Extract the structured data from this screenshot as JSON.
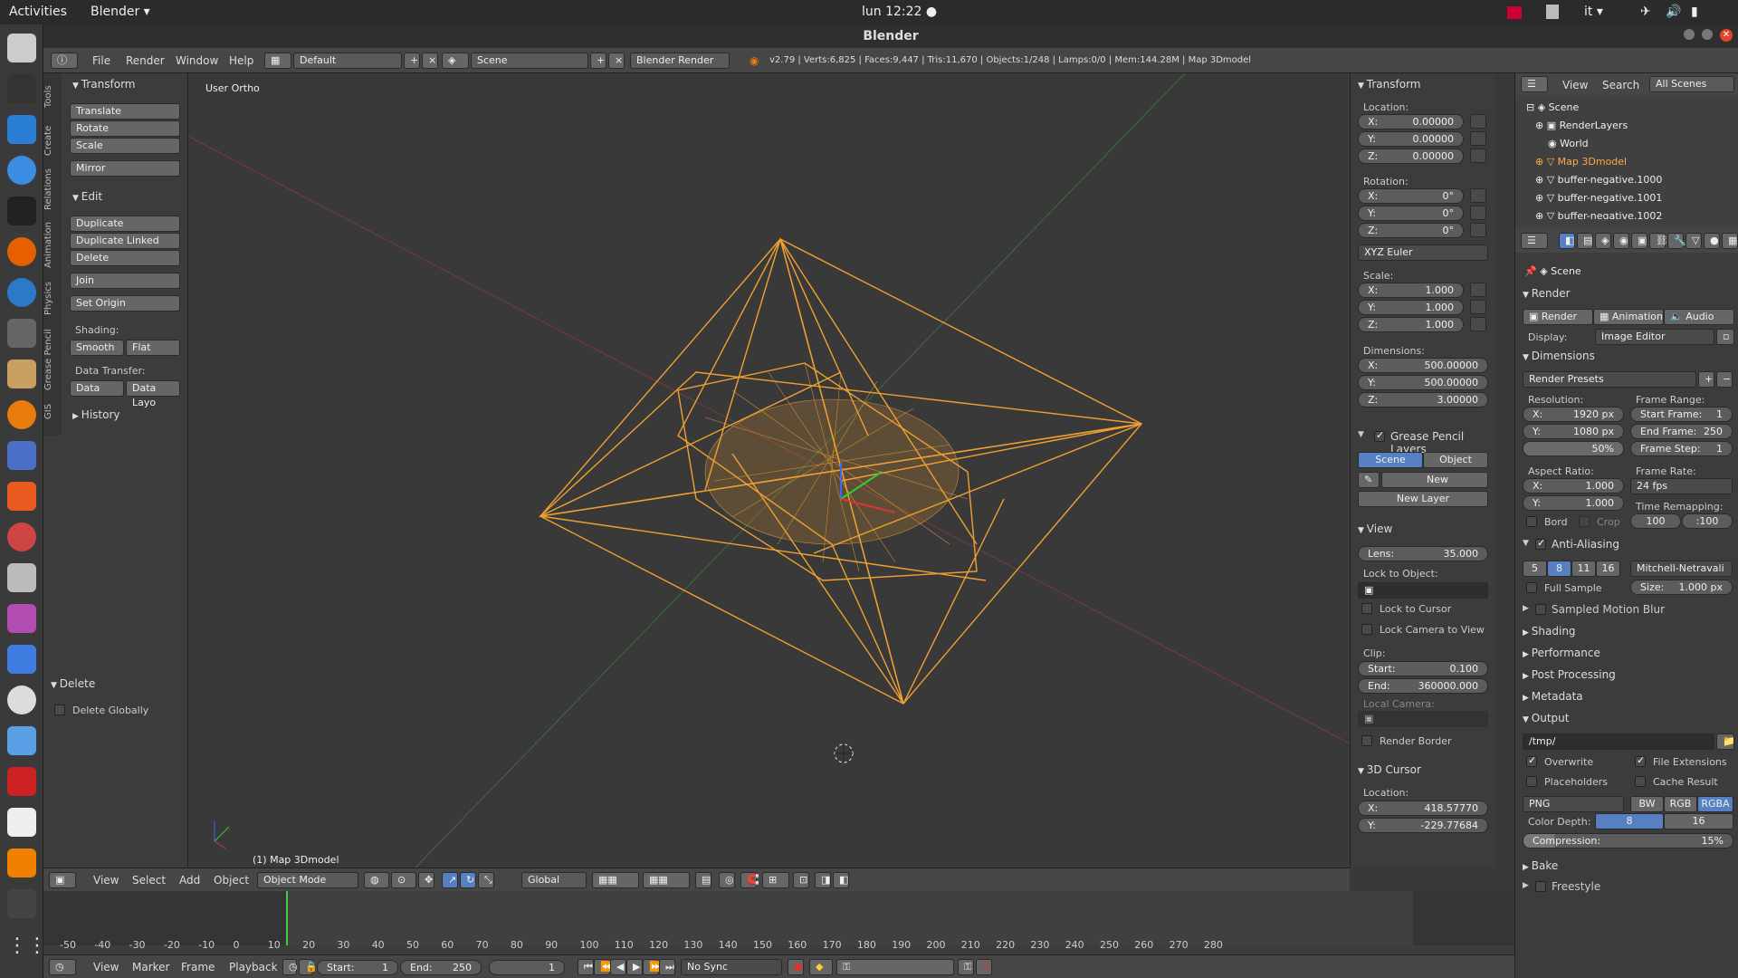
{
  "topbar": {
    "activities": "Activities",
    "app": "Blender ▾",
    "clock": "lun 12:22 ●",
    "lang": "it ▾"
  },
  "window": {
    "title": "Blender"
  },
  "infobar": {
    "menus": [
      "File",
      "Render",
      "Window",
      "Help"
    ],
    "layout": "Default",
    "scene": "Scene",
    "engine": "Blender Render",
    "stats": "v2.79 | Verts:6,825 | Faces:9,447 | Tris:11,670 | Objects:1/248 | Lamps:0/0 | Mem:144.28M | Map 3Dmodel"
  },
  "tools": {
    "tabs": [
      "Tools",
      "Create",
      "Relations",
      "Animation",
      "Physics",
      "Grease Pencil",
      "GIS"
    ],
    "transform_title": "Transform",
    "translate": "Translate",
    "rotate": "Rotate",
    "scale": "Scale",
    "mirror": "Mirror",
    "edit_title": "Edit",
    "duplicate": "Duplicate",
    "duplicate_linked": "Duplicate Linked",
    "delete": "Delete",
    "join": "Join",
    "set_origin": "Set Origin",
    "shading_label": "Shading:",
    "smooth": "Smooth",
    "flat": "Flat",
    "data_transfer_label": "Data Transfer:",
    "data": "Data",
    "data_layo": "Data Layo",
    "history_title": "History",
    "delete_panel_title": "Delete",
    "delete_globally": "Delete Globally"
  },
  "viewport": {
    "view_name": "User Ortho",
    "object_label": "(1) Map 3Dmodel"
  },
  "npanel": {
    "transform_title": "Transform",
    "location_label": "Location:",
    "loc_x": "0.00000",
    "loc_y": "0.00000",
    "loc_z": "0.00000",
    "rotation_label": "Rotation:",
    "rot_x": "0°",
    "rot_y": "0°",
    "rot_z": "0°",
    "rot_mode": "XYZ Euler",
    "scale_label": "Scale:",
    "scale_x": "1.000",
    "scale_y": "1.000",
    "scale_z": "1.000",
    "dimensions_label": "Dimensions:",
    "dim_x": "500.00000",
    "dim_y": "500.00000",
    "dim_z": "3.00000",
    "gp_title": "Grease Pencil Layers",
    "gp_scene": "Scene",
    "gp_object": "Object",
    "gp_new": "New",
    "gp_new_layer": "New Layer",
    "view_title": "View",
    "lens_label": "Lens:",
    "lens": "35.000",
    "lock_to_object": "Lock to Object:",
    "lock_to_cursor": "Lock to Cursor",
    "lock_camera": "Lock Camera to View",
    "clip_label": "Clip:",
    "clip_start_label": "Start:",
    "clip_start": "0.100",
    "clip_end_label": "End:",
    "clip_end": "360000.000",
    "local_camera": "Local Camera:",
    "render_border": "Render Border",
    "cursor_title": "3D Cursor",
    "cursor_location": "Location:",
    "cursor_x": "418.57770",
    "cursor_y": "-229.77684"
  },
  "outliner": {
    "view": "View",
    "search": "Search",
    "all_scenes": "All Scenes",
    "items": [
      "Scene",
      "RenderLayers",
      "World",
      "Map 3Dmodel",
      "buffer-negative.1000",
      "buffer-negative.1001",
      "buffer-negative.1002"
    ]
  },
  "props": {
    "scene": "Scene",
    "render_title": "Render",
    "render_btn": "Render",
    "animation_btn": "Animation",
    "audio_btn": "Audio",
    "display_label": "Display:",
    "display": "Image Editor",
    "dimensions_title": "Dimensions",
    "render_presets": "Render Presets",
    "resolution_label": "Resolution:",
    "res_x": "1920 px",
    "res_y": "1080 px",
    "res_pct": "50%",
    "frame_range_label": "Frame Range:",
    "start_frame": "Start Frame:",
    "start_frame_val": "1",
    "end_frame": "End Frame:",
    "end_frame_val": "250",
    "frame_step": "Frame Step:",
    "frame_step_val": "1",
    "aspect_label": "Aspect Ratio:",
    "aspect_x": "1.000",
    "aspect_y": "1.000",
    "frame_rate_label": "Frame Rate:",
    "fps": "24 fps",
    "time_remap_label": "Time Remapping:",
    "remap_old": "100",
    "remap_new": ":100",
    "bord": "Bord",
    "crop": "Crop",
    "aa_title": "Anti-Aliasing",
    "aa_samples": [
      "5",
      "8",
      "11",
      "16"
    ],
    "aa_filter": "Mitchell-Netravali",
    "full_sample": "Full Sample",
    "aa_size": "Size:",
    "aa_size_val": "1.000 px",
    "collapsed": [
      "Sampled Motion Blur",
      "Shading",
      "Performance",
      "Post Processing",
      "Metadata"
    ],
    "output_title": "Output",
    "output_path": "/tmp/",
    "overwrite": "Overwrite",
    "file_ext": "File Extensions",
    "placeholders": "Placeholders",
    "cache_result": "Cache Result",
    "format": "PNG",
    "bw": "BW",
    "rgb": "RGB",
    "rgba": "RGBA",
    "color_depth_label": "Color Depth:",
    "depth8": "8",
    "depth16": "16",
    "compression": "Compression:",
    "compression_val": "15%",
    "bake": "Bake",
    "freestyle": "Freestyle"
  },
  "vheader": {
    "view": "View",
    "select": "Select",
    "add": "Add",
    "object": "Object",
    "mode": "Object Mode",
    "orientation": "Global"
  },
  "timeline": {
    "ticks": [
      "-50",
      "-40",
      "-30",
      "-20",
      "-10",
      "0",
      "10",
      "20",
      "30",
      "40",
      "50",
      "60",
      "70",
      "80",
      "90",
      "100",
      "110",
      "120",
      "130",
      "140",
      "150",
      "160",
      "170",
      "180",
      "190",
      "200",
      "210",
      "220",
      "230",
      "240",
      "250",
      "260",
      "270",
      "280"
    ],
    "view": "View",
    "marker": "Marker",
    "frame": "Frame",
    "playback": "Playback",
    "start_label": "Start:",
    "start": "1",
    "end_label": "End:",
    "end": "250",
    "current": "1",
    "sync": "No Sync"
  }
}
